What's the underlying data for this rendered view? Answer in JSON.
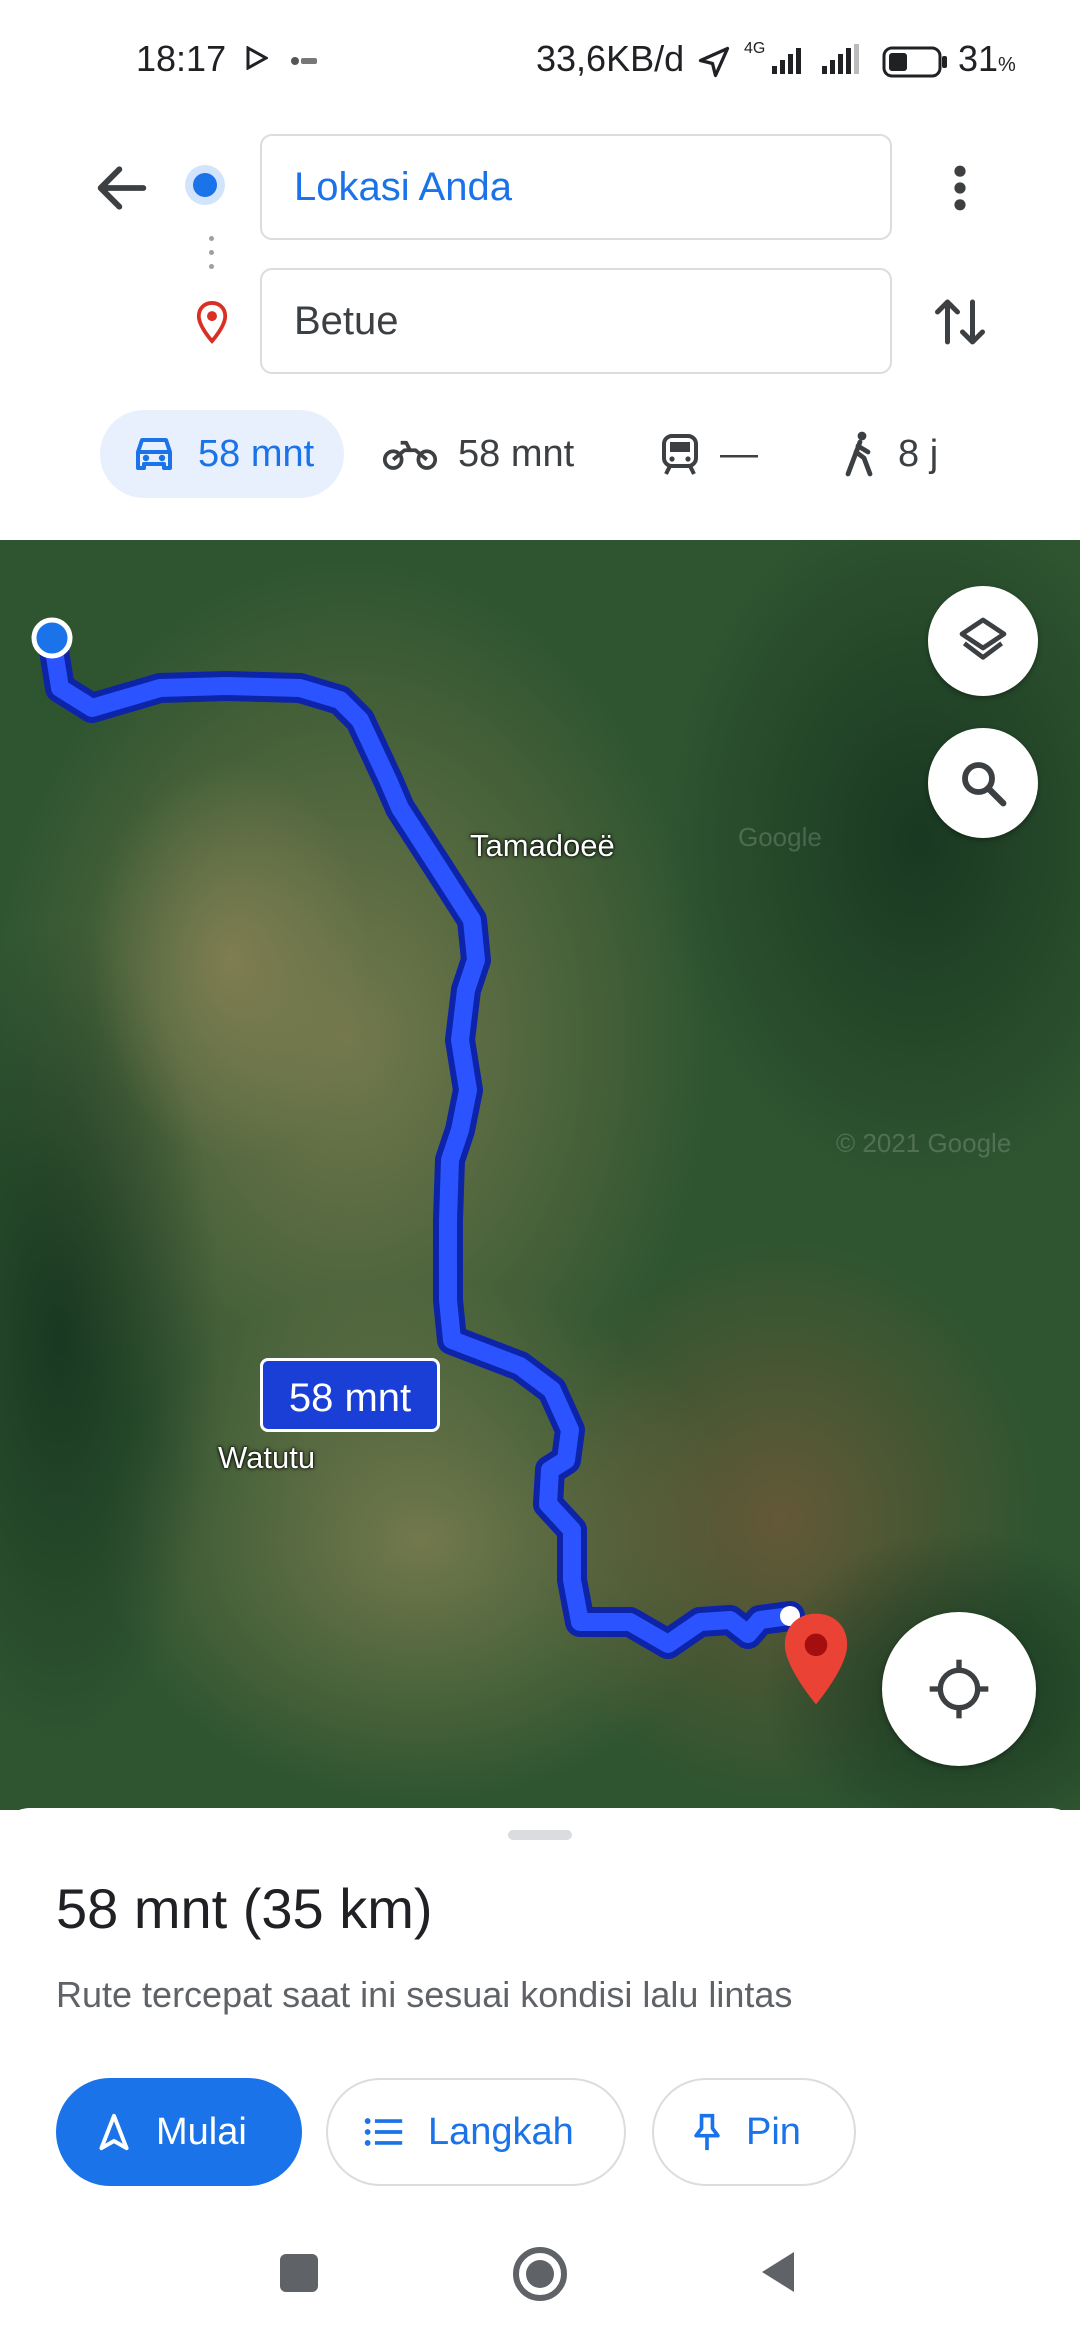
{
  "status_bar": {
    "time": "18:17",
    "speed": "33,6KB/d",
    "network": "4G",
    "battery_pct": "31",
    "battery_unit": "%"
  },
  "search": {
    "origin_value": "Lokasi Anda",
    "destination_value": "Betue"
  },
  "modes": [
    {
      "name": "car",
      "label": "58 mnt",
      "active": true
    },
    {
      "name": "motorcycle",
      "label": "58 mnt"
    },
    {
      "name": "transit",
      "label": "—"
    },
    {
      "name": "walk",
      "label": "8 j"
    }
  ],
  "map": {
    "labels": {
      "tamadoe": "Tamadoeë",
      "watutu": "Watutu"
    },
    "route_badge": "58 mnt",
    "watermarks": [
      "Google",
      "© 2021 Google"
    ],
    "route_color": "#1a3fd6",
    "destination_pin_color": "#d93025"
  },
  "sheet": {
    "title": "58 mnt (35 km)",
    "subtitle": "Rute tercepat saat ini sesuai kondisi lalu lintas",
    "start_label": "Mulai",
    "steps_label": "Langkah",
    "pin_label": "Pin"
  },
  "colors": {
    "accent": "#1a73e8",
    "accent_light": "#e8f0fe"
  }
}
